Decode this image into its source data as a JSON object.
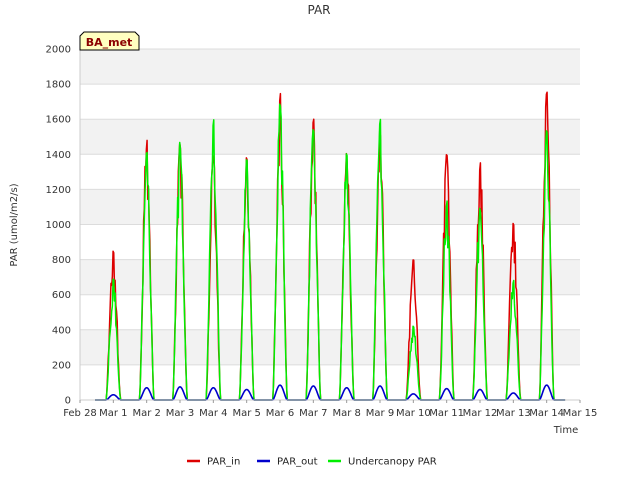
{
  "chart_data": {
    "type": "line",
    "title": "PAR",
    "xlabel": "Time",
    "ylabel": "PAR (umol/m2/s)",
    "ylim": [
      0,
      2000
    ],
    "yticks": [
      0,
      200,
      400,
      600,
      800,
      1000,
      1200,
      1400,
      1600,
      1800,
      2000
    ],
    "xlim": [
      0,
      15
    ],
    "xticks": [
      {
        "value": 0,
        "label": "Feb 28"
      },
      {
        "value": 1,
        "label": "Mar 1"
      },
      {
        "value": 2,
        "label": "Mar 2"
      },
      {
        "value": 3,
        "label": "Mar 3"
      },
      {
        "value": 4,
        "label": "Mar 4"
      },
      {
        "value": 5,
        "label": "Mar 5"
      },
      {
        "value": 6,
        "label": "Mar 6"
      },
      {
        "value": 7,
        "label": "Mar 7"
      },
      {
        "value": 8,
        "label": "Mar 8"
      },
      {
        "value": 9,
        "label": "Mar 9"
      },
      {
        "value": 10,
        "label": "Mar 10"
      },
      {
        "value": 11,
        "label": "Mar 11"
      },
      {
        "value": 12,
        "label": "Mar 12"
      },
      {
        "value": 13,
        "label": "Mar 13"
      },
      {
        "value": 14,
        "label": "Mar 14"
      },
      {
        "value": 15,
        "label": "Mar 15"
      }
    ],
    "grid": true,
    "legend_position": "bottom",
    "site_label": "BA_met",
    "series": [
      {
        "name": "PAR_in",
        "color": "#dd0000",
        "daily_peaks": [
          {
            "day": 1,
            "peak": 850
          },
          {
            "day": 2,
            "peak": 1480
          },
          {
            "day": 3,
            "peak": 1490
          },
          {
            "day": 4,
            "peak": 1420
          },
          {
            "day": 5,
            "peak": 1400
          },
          {
            "day": 6,
            "peak": 1750
          },
          {
            "day": 7,
            "peak": 1610
          },
          {
            "day": 8,
            "peak": 1410
          },
          {
            "day": 9,
            "peak": 1560
          },
          {
            "day": 10,
            "peak": 800
          },
          {
            "day": 11,
            "peak": 1440
          },
          {
            "day": 12,
            "peak": 1360
          },
          {
            "day": 13,
            "peak": 1020
          },
          {
            "day": 14,
            "peak": 1800
          }
        ]
      },
      {
        "name": "PAR_out",
        "color": "#0000cc",
        "daily_peaks": [
          {
            "day": 1,
            "peak": 30
          },
          {
            "day": 2,
            "peak": 70
          },
          {
            "day": 3,
            "peak": 75
          },
          {
            "day": 4,
            "peak": 70
          },
          {
            "day": 5,
            "peak": 60
          },
          {
            "day": 6,
            "peak": 85
          },
          {
            "day": 7,
            "peak": 80
          },
          {
            "day": 8,
            "peak": 70
          },
          {
            "day": 9,
            "peak": 80
          },
          {
            "day": 10,
            "peak": 35
          },
          {
            "day": 11,
            "peak": 65
          },
          {
            "day": 12,
            "peak": 60
          },
          {
            "day": 13,
            "peak": 40
          },
          {
            "day": 14,
            "peak": 85
          }
        ]
      },
      {
        "name": "Undercanopy PAR",
        "color": "#00ee00",
        "daily_peaks": [
          {
            "day": 1,
            "peak": 690
          },
          {
            "day": 2,
            "peak": 1440
          },
          {
            "day": 3,
            "peak": 1470
          },
          {
            "day": 4,
            "peak": 1600
          },
          {
            "day": 5,
            "peak": 1400
          },
          {
            "day": 6,
            "peak": 1710
          },
          {
            "day": 7,
            "peak": 1580
          },
          {
            "day": 8,
            "peak": 1410
          },
          {
            "day": 9,
            "peak": 1620
          },
          {
            "day": 10,
            "peak": 430
          },
          {
            "day": 11,
            "peak": 1140
          },
          {
            "day": 12,
            "peak": 1110
          },
          {
            "day": 13,
            "peak": 690
          },
          {
            "day": 14,
            "peak": 1560
          }
        ]
      }
    ]
  }
}
